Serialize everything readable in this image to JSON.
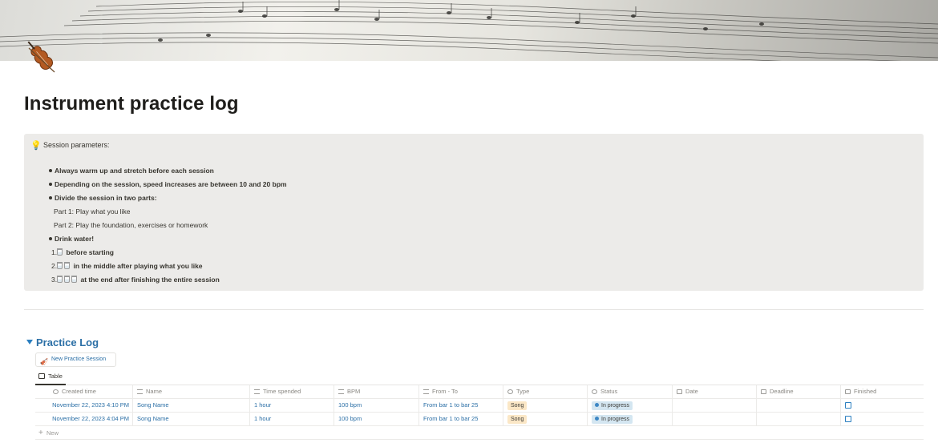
{
  "page": {
    "title": "Instrument practice log",
    "icon": "violin-icon"
  },
  "callout": {
    "icon": "lightbulb-icon",
    "title": "Session parameters:",
    "lines": [
      "Always warm up and stretch before each session",
      "Depending on the session, speed increases are between 10 and 20 bpm",
      "Divide the session in two parts:",
      "Part 1:  Play what you like",
      "Part 2: Play the foundation, exercises or homework",
      "Drink water!",
      "before starting",
      "in the middle after playing what you like",
      "at the end after finishing the entire session"
    ],
    "numbers": [
      "1.",
      "2.",
      "3."
    ]
  },
  "database": {
    "title": "Practice Log",
    "new_session_label": "New Practice Session",
    "view_tab": "Table",
    "add_row_label": "New",
    "columns": [
      "Created time",
      "Name",
      "Time spended",
      "BPM",
      "From - To",
      "Type",
      "Status",
      "Date",
      "Deadline",
      "Finished"
    ],
    "rows": [
      {
        "created": "November 22, 2023 4:10 PM",
        "name": "Song Name",
        "time": "1 hour",
        "bpm": "100 bpm",
        "from_to": "From bar  1  to bar  25",
        "type": "Song",
        "status": "In progress",
        "date": "",
        "deadline": ""
      },
      {
        "created": "November 22, 2023 4:04 PM",
        "name": "Song Name",
        "time": "1 hour",
        "bpm": "100 bpm",
        "from_to": "From bar  1  to bar  25",
        "type": "Song",
        "status": "In progress",
        "date": "",
        "deadline": ""
      }
    ]
  },
  "colors": {
    "accent": "#2b6fa6",
    "callout_bg": "#ecebe9",
    "tag_song": "#fbe7c6",
    "tag_status": "#d4e6f1"
  }
}
